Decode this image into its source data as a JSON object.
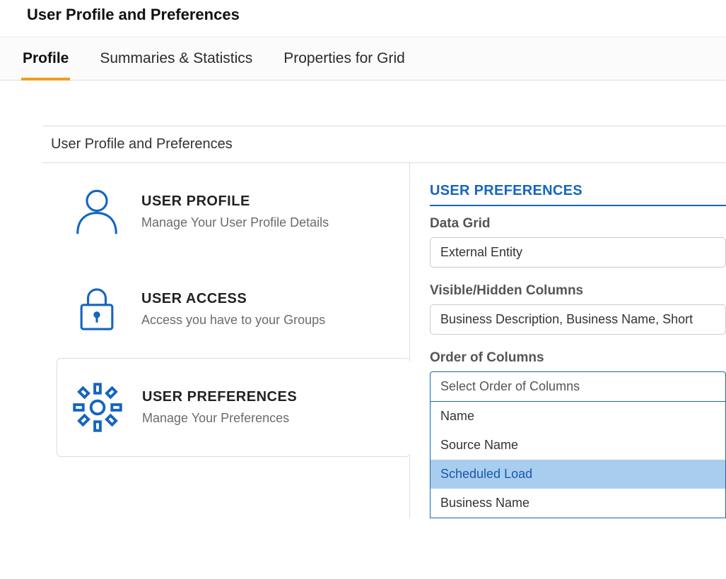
{
  "page": {
    "title": "User Profile and Preferences"
  },
  "tabs": [
    {
      "label": "Profile",
      "active": true
    },
    {
      "label": "Summaries & Statistics",
      "active": false
    },
    {
      "label": "Properties for Grid",
      "active": false
    }
  ],
  "section_header": "User Profile and Preferences",
  "nav_items": [
    {
      "icon": "user-icon",
      "title": "USER PROFILE",
      "subtitle": "Manage Your User Profile Details"
    },
    {
      "icon": "lock-icon",
      "title": "USER ACCESS",
      "subtitle": "Access you have to your Groups"
    },
    {
      "icon": "gear-icon",
      "title": "USER PREFERENCES",
      "subtitle": "Manage Your Preferences",
      "selected": true
    }
  ],
  "preferences": {
    "panel_title": "USER PREFERENCES",
    "fields": {
      "data_grid": {
        "label": "Data Grid",
        "value": "External Entity"
      },
      "visible_columns": {
        "label": "Visible/Hidden Columns",
        "value": "Business Description,  Business Name,  Short"
      },
      "order_columns": {
        "label": "Order of Columns",
        "placeholder": "Select Order of Columns",
        "options": [
          {
            "label": "Name"
          },
          {
            "label": "Source Name"
          },
          {
            "label": "Scheduled Load",
            "highlighted": true
          },
          {
            "label": "Business Name"
          }
        ]
      }
    }
  }
}
